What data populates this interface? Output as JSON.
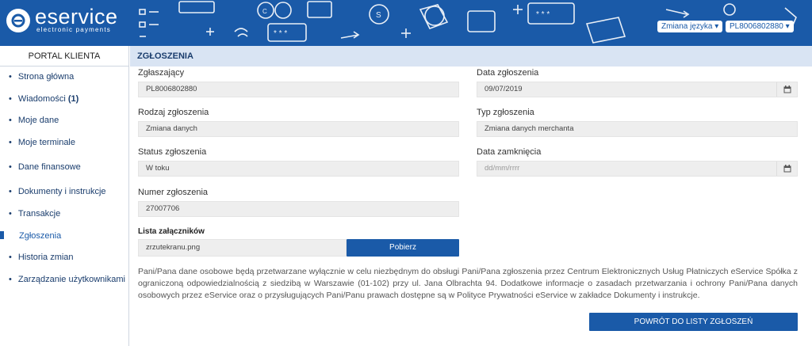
{
  "header": {
    "logo_main": "eservice",
    "logo_sub": "electronic payments",
    "language_label": "Zmiana języka",
    "account_label": "PL8006802880"
  },
  "sidebar": {
    "title": "PORTAL KLIENTA",
    "items": [
      {
        "label": "Strona główna"
      },
      {
        "label": "Wiadomości",
        "count": "(1)"
      },
      {
        "label": "Moje dane"
      },
      {
        "label": "Moje terminale"
      },
      {
        "label": "Dane finansowe"
      },
      {
        "label": "Dokumenty i instrukcje"
      },
      {
        "label": "Transakcje"
      },
      {
        "label": "Zgłoszenia"
      },
      {
        "label": "Historia zmian"
      },
      {
        "label": "Zarządzanie użytkownikami"
      }
    ]
  },
  "main": {
    "section_title": "ZGŁOSZENIA",
    "fields": {
      "reporter_label": "Zgłaszający",
      "reporter_value": "PL8006802880",
      "date_label": "Data zgłoszenia",
      "date_value": "09/07/2019",
      "kind_label": "Rodzaj zgłoszenia",
      "kind_value": "Zmiana danych",
      "type_label": "Typ zgłoszenia",
      "type_value": "Zmiana danych merchanta",
      "status_label": "Status zgłoszenia",
      "status_value": "W toku",
      "close_label": "Data zamknięcia",
      "close_placeholder": "dd/mm/rrrr",
      "number_label": "Numer zgłoszenia",
      "number_value": "27007706"
    },
    "attachments_title": "Lista załączników",
    "attachment_name": "zrzutekranu.png",
    "download_label": "Pobierz",
    "info_text": "Pani/Pana dane osobowe będą przetwarzane wyłącznie w celu niezbędnym do obsługi Pani/Pana zgłoszenia przez Centrum Elektronicznych Usług Płatniczych eService Spółka z ograniczoną odpowiedzialnością z siedzibą w Warszawie (01-102) przy ul. Jana Olbrachta 94. Dodatkowe informacje o zasadach przetwarzania i ochrony Pani/Pana danych osobowych przez eService oraz o przysługujących Pani/Panu prawach dostępne są w Polityce Prywatności eService w zakładce Dokumenty i instrukcje.",
    "back_label": "POWRÓT DO LISTY ZGŁOSZEŃ"
  },
  "colors": {
    "brand": "#1a5aa8",
    "section_bg": "#d9e4f3"
  }
}
